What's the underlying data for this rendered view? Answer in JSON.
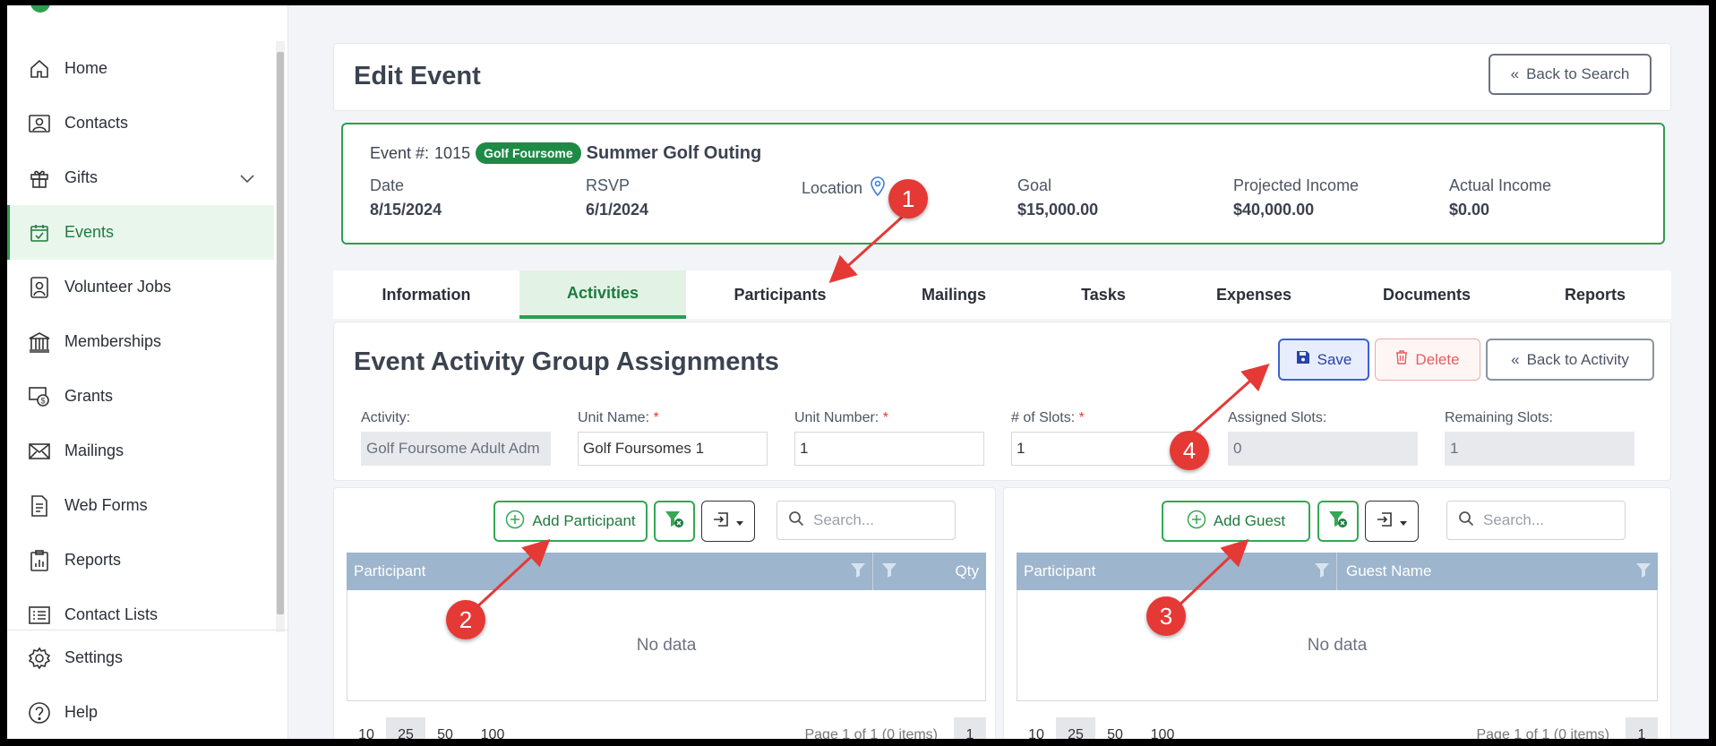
{
  "sidebar": {
    "items": [
      {
        "label": "Home",
        "icon": "home-icon"
      },
      {
        "label": "Contacts",
        "icon": "contact-card-icon"
      },
      {
        "label": "Gifts",
        "icon": "gift-icon"
      },
      {
        "label": "Events",
        "icon": "calendar-check-icon"
      },
      {
        "label": "Volunteer Jobs",
        "icon": "badge-icon"
      },
      {
        "label": "Memberships",
        "icon": "building-icon"
      },
      {
        "label": "Grants",
        "icon": "money-icon"
      },
      {
        "label": "Mailings",
        "icon": "envelope-icon"
      },
      {
        "label": "Web Forms",
        "icon": "form-icon"
      },
      {
        "label": "Reports",
        "icon": "clipboard-chart-icon"
      },
      {
        "label": "Contact Lists",
        "icon": "list-icon"
      }
    ],
    "bottom": [
      {
        "label": "Settings",
        "icon": "gear-icon"
      },
      {
        "label": "Help",
        "icon": "help-icon"
      }
    ]
  },
  "header": {
    "title": "Edit Event",
    "back_label": "Back to Search"
  },
  "event": {
    "number_label": "Event #:",
    "number": "1015",
    "tag": "Golf Foursome",
    "name": "Summer Golf Outing",
    "stats": [
      {
        "label": "Date",
        "value": "8/15/2024"
      },
      {
        "label": "RSVP",
        "value": "6/1/2024"
      },
      {
        "label": "Location",
        "value": ""
      },
      {
        "label": "Goal",
        "value": "$15,000.00"
      },
      {
        "label": "Projected Income",
        "value": "$40,000.00"
      },
      {
        "label": "Actual Income",
        "value": "$0.00"
      }
    ]
  },
  "tabs": [
    "Information",
    "Activities",
    "Participants",
    "Mailings",
    "Tasks",
    "Expenses",
    "Documents",
    "Reports"
  ],
  "assign": {
    "title": "Event Activity Group Assignments",
    "save_label": "Save",
    "delete_label": "Delete",
    "back_label": "Back to Activity",
    "fields": {
      "activity_label": "Activity:",
      "activity_value": "Golf Foursome Adult Adm",
      "unit_name_label": "Unit Name:",
      "unit_name_value": "Golf Foursomes 1",
      "unit_number_label": "Unit Number:",
      "unit_number_value": "1",
      "slots_label": "# of Slots:",
      "slots_value": "1",
      "assigned_label": "Assigned Slots:",
      "assigned_value": "0",
      "remaining_label": "Remaining Slots:",
      "remaining_value": "1",
      "required_mark": "*"
    }
  },
  "left_grid": {
    "add_label": "Add Participant",
    "search_placeholder": "Search...",
    "columns": [
      "Participant",
      "Qty"
    ],
    "empty": "No data",
    "page_sizes": [
      "10",
      "25",
      "50",
      "100"
    ],
    "page_info": "Page 1 of 1 (0 items)",
    "page": "1"
  },
  "right_grid": {
    "add_label": "Add Guest",
    "search_placeholder": "Search...",
    "columns": [
      "Participant",
      "Guest Name"
    ],
    "empty": "No data",
    "page_sizes": [
      "10",
      "25",
      "50",
      "100"
    ],
    "page_info": "Page 1 of 1 (0 items)",
    "page": "1"
  },
  "annotations": [
    "1",
    "2",
    "3",
    "4"
  ],
  "colors": {
    "brand_green": "#2e9e4f",
    "grid_header": "#9db5cd",
    "annotation_red": "#e53935"
  }
}
